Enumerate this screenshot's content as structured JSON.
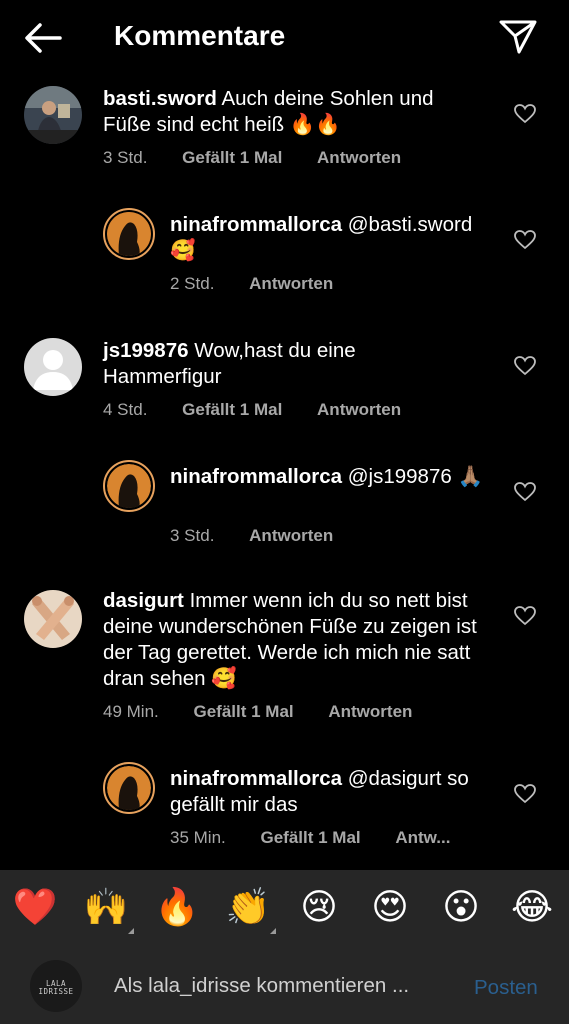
{
  "header": {
    "title": "Kommentare",
    "back_icon": "arrow-left-icon",
    "send_icon": "paper-plane-icon"
  },
  "comments": [
    {
      "username": "basti.sword",
      "text": " Auch deine Sohlen und Füße sind echt heiß 🔥🔥",
      "time": "3 Std.",
      "likes": "Gefällt 1 Mal",
      "reply": "Antworten"
    },
    {
      "username": "ninafrommallorca",
      "text": " @basti.sword 🥰",
      "time": "2 Std.",
      "reply": "Antworten"
    },
    {
      "username": "js199876",
      "text": " Wow,hast du eine Hammerfigur",
      "time": "4 Std.",
      "likes": "Gefällt 1 Mal",
      "reply": "Antworten"
    },
    {
      "username": "ninafrommallorca",
      "text": " @js199876 🙏🏽",
      "time": "3 Std.",
      "reply": "Antworten"
    },
    {
      "username": "dasigurt",
      "text": " Immer wenn ich du so nett bist deine wunderschönen Füße zu zeigen ist der Tag gerettet. Werde ich mich nie satt dran sehen 🥰",
      "time": "49 Min.",
      "likes": "Gefällt 1 Mal",
      "reply": "Antworten"
    },
    {
      "username": "ninafrommallorca",
      "text": " @dasigurt so gefällt mir das",
      "time": "35 Min.",
      "likes": "Gefällt 1 Mal",
      "reply": "Antw..."
    }
  ],
  "emoji_bar": [
    "❤️",
    "🙌",
    "🔥",
    "👏",
    "😢",
    "😍",
    "😮",
    "😂"
  ],
  "composer": {
    "avatar_label_line1": "LALA",
    "avatar_label_line2": "IDRISSE",
    "placeholder": "Als lala_idrisse kommentieren ...",
    "post_label": "Posten"
  },
  "colors": {
    "background": "#000000",
    "bar": "#262626",
    "meta": "#a8a8a8",
    "post_disabled": "#2a5f8f",
    "story_ring": "#e7a25e"
  }
}
